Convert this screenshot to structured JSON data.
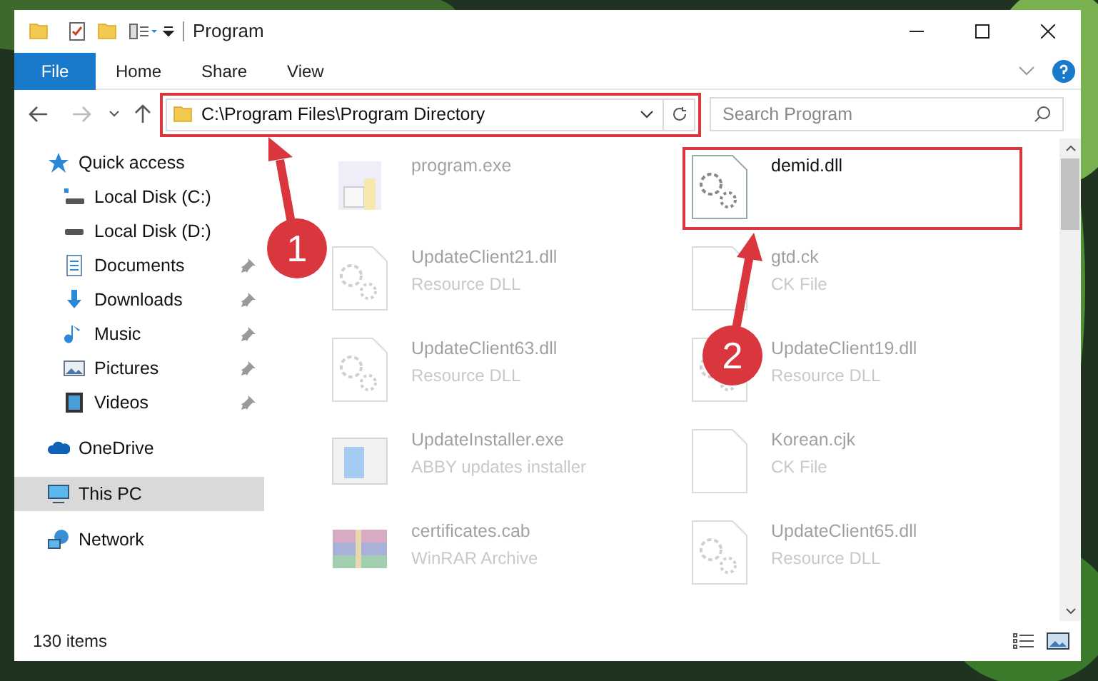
{
  "window": {
    "title": "Program"
  },
  "ribbon_tabs": [
    {
      "label": "File",
      "kind": "file",
      "selected": false
    },
    {
      "label": "Home",
      "kind": "tab",
      "selected": false
    },
    {
      "label": "Share",
      "kind": "tab",
      "selected": false
    },
    {
      "label": "View",
      "kind": "tab",
      "selected": false
    }
  ],
  "address": {
    "path": "C:\\Program Files\\Program Directory"
  },
  "search": {
    "placeholder": "Search Program"
  },
  "sidebar": {
    "items": [
      {
        "label": "Quick access",
        "kind": "star",
        "pinned": false,
        "selected": false,
        "children": [
          {
            "label": "Local Disk (C:)",
            "kind": "disk-c",
            "pinned": false,
            "selected": false
          },
          {
            "label": "Local Disk (D:)",
            "kind": "disk",
            "pinned": false,
            "selected": false
          },
          {
            "label": "Documents",
            "kind": "documents",
            "pinned": true,
            "selected": false
          },
          {
            "label": "Downloads",
            "kind": "downloads",
            "pinned": true,
            "selected": false
          },
          {
            "label": "Music",
            "kind": "music",
            "pinned": true,
            "selected": false
          },
          {
            "label": "Pictures",
            "kind": "pictures",
            "pinned": true,
            "selected": false
          },
          {
            "label": "Videos",
            "kind": "videos",
            "pinned": true,
            "selected": false
          }
        ]
      },
      {
        "label": "OneDrive",
        "kind": "cloud",
        "pinned": false,
        "selected": false
      },
      {
        "label": "This PC",
        "kind": "pc",
        "pinned": false,
        "selected": true
      },
      {
        "label": "Network",
        "kind": "network",
        "pinned": false,
        "selected": false
      }
    ]
  },
  "files": [
    {
      "name": "program.exe",
      "kind": "exe",
      "highlighted": false
    },
    {
      "name": "demid.dll",
      "kind": "dll",
      "highlighted": true
    },
    {
      "name": "UpdateClient21.dll",
      "type": "Resource DLL",
      "kind": "dll",
      "highlighted": false
    },
    {
      "name": "gtd.ck",
      "type": "CK File",
      "kind": "doc",
      "highlighted": false
    },
    {
      "name": "UpdateClient63.dll",
      "type": "Resource DLL",
      "kind": "dll",
      "highlighted": false
    },
    {
      "name": "UpdateClient19.dll",
      "type": "Resource DLL",
      "kind": "dll",
      "highlighted": false
    },
    {
      "name": "UpdateInstaller.exe",
      "type": "ABBY updates installer",
      "kind": "installer",
      "highlighted": false
    },
    {
      "name": "Korean.cjk",
      "type": "CK File",
      "kind": "doc",
      "highlighted": false
    },
    {
      "name": "certificates.cab",
      "type": "WinRAR Archive",
      "kind": "archive",
      "highlighted": false
    },
    {
      "name": "UpdateClient65.dll",
      "type": "Resource DLL",
      "kind": "dll",
      "highlighted": false
    }
  ],
  "status_bar": {
    "count": "130 items"
  },
  "steps": [
    {
      "number": "1"
    },
    {
      "number": "2"
    }
  ]
}
